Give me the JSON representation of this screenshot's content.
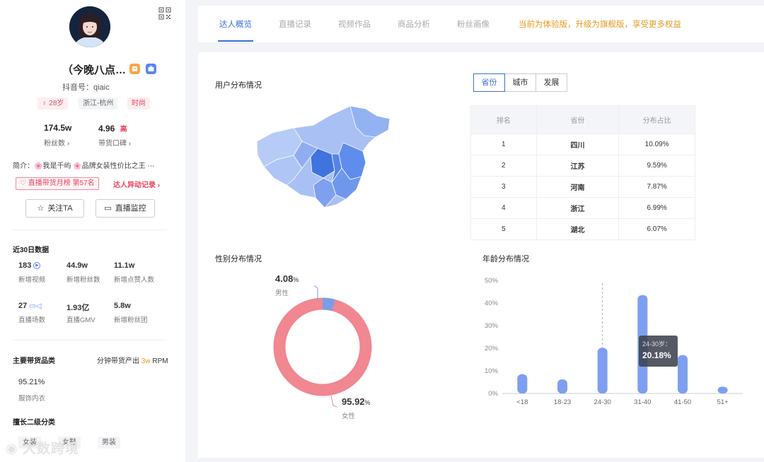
{
  "profile": {
    "nickname": "（今晚八点…",
    "douyin_id": "抖音号：qiaic",
    "tags": [
      "28岁",
      "浙江-杭州",
      "时尚"
    ],
    "fans": {
      "value": "174.5w",
      "label": "粉丝数 ›"
    },
    "reputation": {
      "value": "4.96",
      "level": "高",
      "label": "带货口碑 ›"
    },
    "intro": "简介：🌸我是千屿 🌸品牌女装性价比之王 ⋯",
    "rank_badge": "♡ 直播带货月榜 第57名",
    "abnormal_link": "达人异动记录 ›",
    "follow_label": "关注TA",
    "monitor_label": "直播监控"
  },
  "recent30": {
    "title": "近30日数据",
    "items": [
      {
        "value": "183",
        "label": "新增视频"
      },
      {
        "value": "44.9w",
        "label": "新增粉丝数"
      },
      {
        "value": "11.1w",
        "label": "新增点赞人数"
      },
      {
        "value": "27",
        "label": "直播场数"
      },
      {
        "value": "1.93亿",
        "label": "直播GMV"
      },
      {
        "value": "5.8w",
        "label": "新增粉丝团"
      }
    ]
  },
  "category": {
    "title": "主要带货品类",
    "rpm_label": "分钟带货产出",
    "rpm_value": "3w",
    "rpm_unit": "RPM",
    "percent": "95.21%",
    "name": "服饰内衣",
    "sub_title": "擅长二级分类",
    "sub_tags": [
      "女装",
      "女鞋",
      "男装"
    ]
  },
  "tabs": [
    "达人概览",
    "直播记录",
    "视频作品",
    "商品分析",
    "粉丝画像"
  ],
  "promo": "当前为体验版，升级为旗舰版，享受更多权益",
  "user_dist": {
    "title": "用户分布情况",
    "seg": [
      "省份",
      "城市",
      "发展"
    ],
    "headers": [
      "排名",
      "省份",
      "分布占比"
    ],
    "rows": [
      [
        "1",
        "四川",
        "10.09%"
      ],
      [
        "2",
        "江苏",
        "9.59%"
      ],
      [
        "3",
        "河南",
        "7.87%"
      ],
      [
        "4",
        "浙江",
        "6.99%"
      ],
      [
        "5",
        "湖北",
        "6.07%"
      ]
    ]
  },
  "gender": {
    "title": "性别分布情况",
    "male_value": "4.08",
    "male_label": "男性",
    "female_value": "95.92",
    "female_label": "女性",
    "male_color": "#7a9ee8",
    "female_color": "#f08791"
  },
  "watermark": "大数跨境",
  "chart_data": {
    "type": "bar",
    "title": "年龄分布情况",
    "categories": [
      "<18",
      "18-23",
      "24-30",
      "31-40",
      "41-50",
      "51+"
    ],
    "values": [
      8.5,
      6.2,
      20.18,
      43.5,
      17.0,
      3.0
    ],
    "yticks": [
      "0%",
      "10%",
      "20%",
      "30%",
      "40%",
      "50%"
    ],
    "ylim": [
      0,
      50
    ],
    "grid": false,
    "tooltip": {
      "label": "24-30岁：",
      "value": "20.18%"
    },
    "bar_color": "#7e9ff0"
  }
}
